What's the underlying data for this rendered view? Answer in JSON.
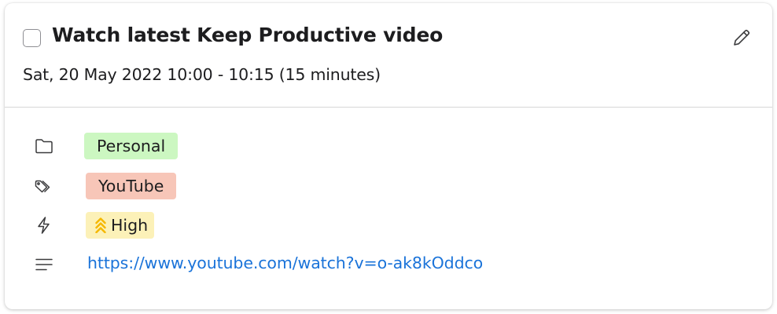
{
  "task": {
    "title": "Watch latest Keep Productive video",
    "datetime": "Sat, 20 May 2022  10:00 - 10:15 (15 minutes)",
    "completed": false
  },
  "details": {
    "project": {
      "icon": "folder-icon",
      "label": "Personal",
      "color": "#ccf7c1"
    },
    "tags": [
      {
        "icon": "tag-icon",
        "label": "YouTube",
        "color": "#f7c6b8"
      }
    ],
    "priority": {
      "icon": "lightning-icon",
      "badge_icon": "double-chevron-up-icon",
      "label": "High",
      "color": "#fcf1b8",
      "badge_icon_color": "#f5b800"
    },
    "notes": {
      "icon": "notes-lines-icon",
      "link": "https://www.youtube.com/watch?v=o-ak8kOddco",
      "link_color": "#1a73d9"
    }
  },
  "actions": {
    "edit_icon": "pencil-icon"
  }
}
